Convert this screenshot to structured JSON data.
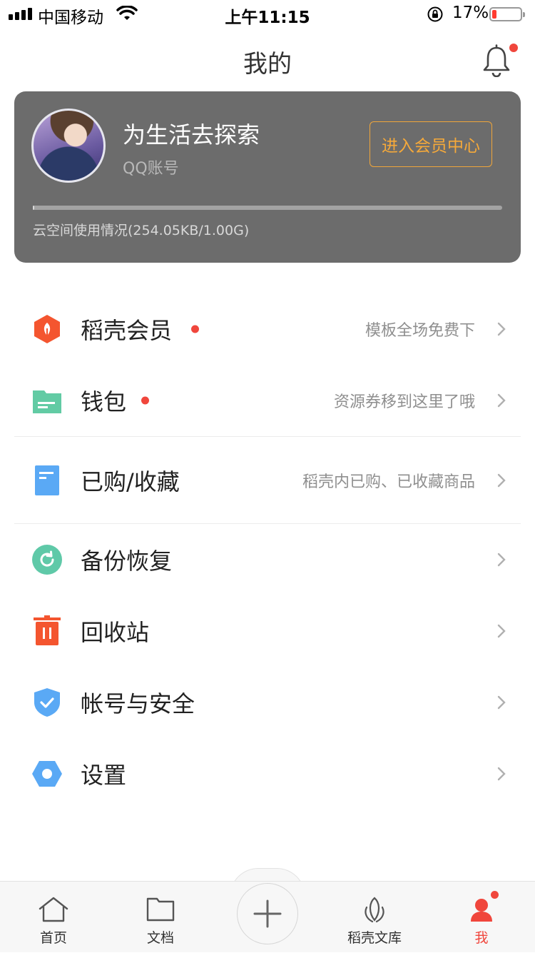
{
  "status_bar": {
    "carrier": "中国移动",
    "time": "上午11:15",
    "battery": "17%",
    "battery_level": 0.17
  },
  "header": {
    "title": "我的",
    "bell_icon": "bell-icon",
    "has_notification": true
  },
  "profile": {
    "username": "为生活去探索",
    "account_type": "QQ账号",
    "vip_button": "进入会员中心",
    "storage_text": "云空间使用情况(254.05KB/1.00G)",
    "storage_used_fraction": 0.0002
  },
  "menu": [
    {
      "id": "vip",
      "label": "稻壳会员",
      "hint": "模板全场免费下",
      "icon": "docer-vip-icon",
      "color": "#f4552f",
      "dot": true
    },
    {
      "id": "wallet",
      "label": "钱包",
      "hint": "资源券移到这里了哦",
      "icon": "wallet-icon",
      "color": "#62cba4",
      "dot": true
    },
    {
      "id": "purchased",
      "label": "已购/收藏",
      "hint": "稻壳内已购、已收藏商品",
      "icon": "purchased-icon",
      "color": "#5aa9f5",
      "dot": false
    },
    {
      "id": "backup",
      "label": "备份恢复",
      "hint": "",
      "icon": "backup-restore-icon",
      "color": "#5fc9a8",
      "dot": false
    },
    {
      "id": "recycle",
      "label": "回收站",
      "hint": "",
      "icon": "trash-icon",
      "color": "#f4552f",
      "dot": false
    },
    {
      "id": "security",
      "label": "帐号与安全",
      "hint": "",
      "icon": "shield-icon",
      "color": "#5aa9f5",
      "dot": false
    },
    {
      "id": "settings",
      "label": "设置",
      "hint": "",
      "icon": "settings-icon",
      "color": "#5aa9f5",
      "dot": false
    }
  ],
  "tabbar": {
    "tabs": [
      {
        "label": "首页",
        "icon": "home-icon",
        "active": false
      },
      {
        "label": "文档",
        "icon": "folder-icon",
        "active": false
      },
      {
        "label": "稻壳文库",
        "icon": "docer-library-icon",
        "active": false
      },
      {
        "label": "我",
        "icon": "profile-icon",
        "active": true
      }
    ],
    "center_button_icon": "plus-icon",
    "accent": "#f0463c"
  }
}
